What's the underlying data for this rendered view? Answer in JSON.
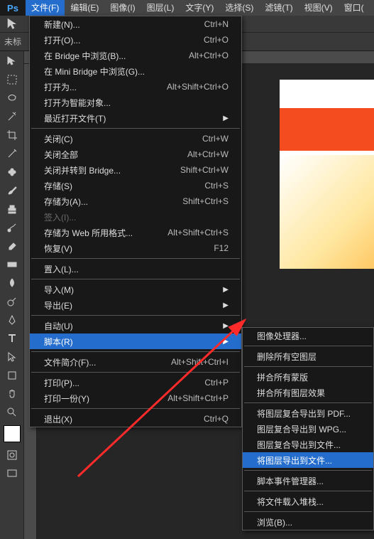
{
  "app": {
    "logo": "Ps"
  },
  "menubar": {
    "items": [
      "文件(F)",
      "编辑(E)",
      "图像(I)",
      "图层(L)",
      "文字(Y)",
      "选择(S)",
      "滤镜(T)",
      "视图(V)",
      "窗口("
    ]
  },
  "tabstrip": {
    "label": "未标"
  },
  "file_menu": [
    {
      "label": "新建(N)...",
      "shortcut": "Ctrl+N"
    },
    {
      "label": "打开(O)...",
      "shortcut": "Ctrl+O"
    },
    {
      "label": "在 Bridge 中浏览(B)...",
      "shortcut": "Alt+Ctrl+O"
    },
    {
      "label": "在 Mini Bridge 中浏览(G)..."
    },
    {
      "label": "打开为...",
      "shortcut": "Alt+Shift+Ctrl+O"
    },
    {
      "label": "打开为智能对象..."
    },
    {
      "label": "最近打开文件(T)",
      "submenu": true
    },
    {
      "sep": true
    },
    {
      "label": "关闭(C)",
      "shortcut": "Ctrl+W"
    },
    {
      "label": "关闭全部",
      "shortcut": "Alt+Ctrl+W"
    },
    {
      "label": "关闭并转到 Bridge...",
      "shortcut": "Shift+Ctrl+W"
    },
    {
      "label": "存储(S)",
      "shortcut": "Ctrl+S"
    },
    {
      "label": "存储为(A)...",
      "shortcut": "Shift+Ctrl+S"
    },
    {
      "label": "签入(I)...",
      "disabled": true
    },
    {
      "label": "存储为 Web 所用格式...",
      "shortcut": "Alt+Shift+Ctrl+S"
    },
    {
      "label": "恢复(V)",
      "shortcut": "F12"
    },
    {
      "sep": true
    },
    {
      "label": "置入(L)..."
    },
    {
      "sep": true
    },
    {
      "label": "导入(M)",
      "submenu": true
    },
    {
      "label": "导出(E)",
      "submenu": true
    },
    {
      "sep": true
    },
    {
      "label": "自动(U)",
      "submenu": true
    },
    {
      "label": "脚本(R)",
      "submenu": true,
      "highlight": true
    },
    {
      "sep": true
    },
    {
      "label": "文件简介(F)...",
      "shortcut": "Alt+Shift+Ctrl+I"
    },
    {
      "sep": true
    },
    {
      "label": "打印(P)...",
      "shortcut": "Ctrl+P"
    },
    {
      "label": "打印一份(Y)",
      "shortcut": "Alt+Shift+Ctrl+P"
    },
    {
      "sep": true
    },
    {
      "label": "退出(X)",
      "shortcut": "Ctrl+Q"
    }
  ],
  "sub_menu": [
    {
      "label": "图像处理器..."
    },
    {
      "sep": true
    },
    {
      "label": "删除所有空图层"
    },
    {
      "sep": true
    },
    {
      "label": "拼合所有蒙版"
    },
    {
      "label": "拼合所有图层效果"
    },
    {
      "sep": true
    },
    {
      "label": "将图层复合导出到 PDF..."
    },
    {
      "label": "图层复合导出到 WPG..."
    },
    {
      "label": "图层复合导出到文件..."
    },
    {
      "label": "将图层导出到文件...",
      "highlight": true
    },
    {
      "sep": true
    },
    {
      "label": "脚本事件管理器..."
    },
    {
      "sep": true
    },
    {
      "label": "将文件载入堆栈..."
    },
    {
      "sep": true
    },
    {
      "label": "浏览(B)..."
    }
  ]
}
